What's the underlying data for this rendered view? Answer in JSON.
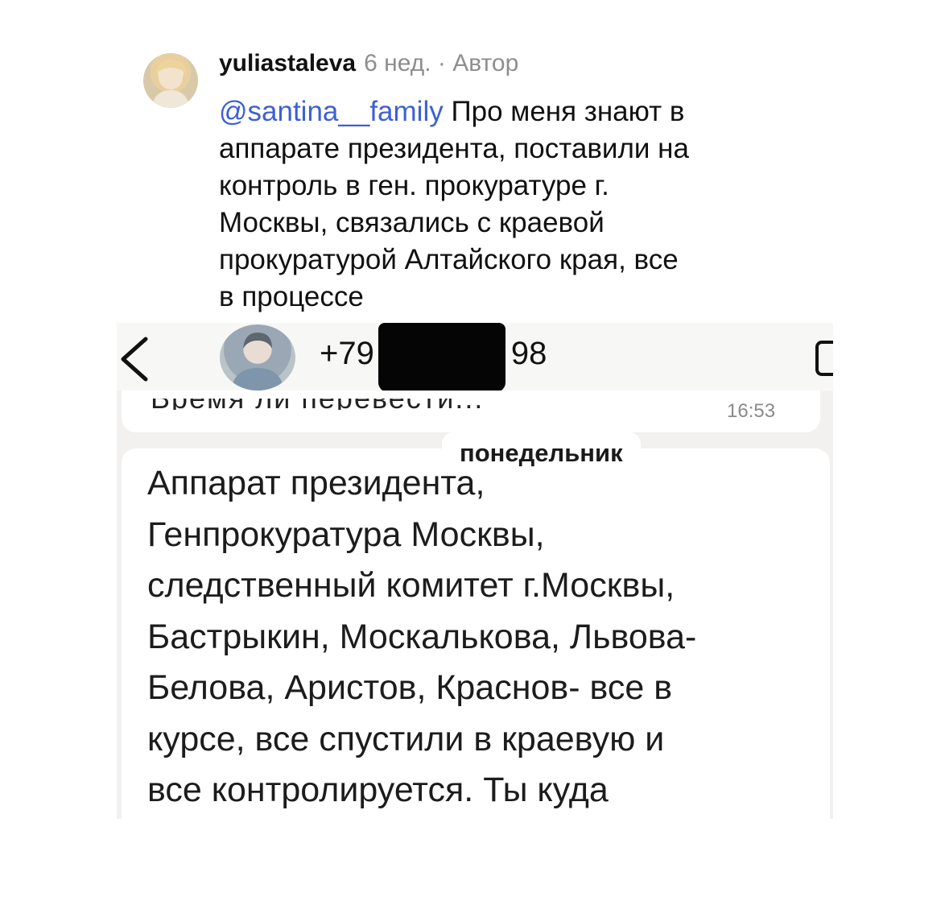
{
  "comment": {
    "username": "yuliastaleva",
    "meta": "6 нед. · Автор",
    "mention": "@santina__family",
    "text_lines": [
      " Про меня знают в",
      "аппарате президента, поставили на",
      "контроль в ген. прокуратуре г.",
      "Москвы, связались с краевой",
      "прокуратурой Алтайского края, все",
      "в процессе"
    ]
  },
  "chat": {
    "phone_left": "+79",
    "phone_right": "98",
    "prev_message_partial": "Время ли перевести...",
    "prev_time": "16:53",
    "date_label": "понедельник",
    "message_lines": [
      "Аппарат президента,",
      "Генпрокуратура Москвы,",
      "следственный комитет г.Москвы,",
      "Бастрыкин, Москалькова, Львова-",
      "Белова, Аристов, Краснов- все в",
      "курсе, все спустили в краевую и",
      "все контролируется. Ты куда"
    ]
  },
  "icons": {
    "back": "chevron-left-icon",
    "video": "video-call-icon"
  },
  "colors": {
    "mention": "#3d5fd6",
    "meta": "#8e8e8e",
    "chat_background": "#f2f1ef"
  }
}
